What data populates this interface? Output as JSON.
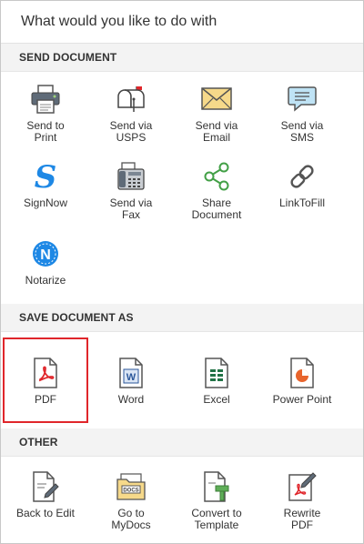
{
  "header": {
    "title": "What would you like to do with"
  },
  "sections": {
    "send": {
      "title": "SEND DOCUMENT",
      "items": [
        {
          "label": "Send to\nPrint",
          "icon": "printer-icon"
        },
        {
          "label": "Send via\nUSPS",
          "icon": "mailbox-icon"
        },
        {
          "label": "Send via\nEmail",
          "icon": "envelope-icon"
        },
        {
          "label": "Send via\nSMS",
          "icon": "chat-bubble-icon"
        },
        {
          "label": "SignNow",
          "icon": "signnow-icon"
        },
        {
          "label": "Send via\nFax",
          "icon": "fax-icon"
        },
        {
          "label": "Share\nDocument",
          "icon": "share-icon"
        },
        {
          "label": "LinkToFill",
          "icon": "link-icon"
        },
        {
          "label": "Notarize",
          "icon": "notarize-icon"
        }
      ]
    },
    "save": {
      "title": "SAVE DOCUMENT AS",
      "items": [
        {
          "label": "PDF",
          "icon": "pdf-file-icon",
          "selected": true
        },
        {
          "label": "Word",
          "icon": "word-file-icon"
        },
        {
          "label": "Excel",
          "icon": "excel-file-icon"
        },
        {
          "label": "Power Point",
          "icon": "powerpoint-file-icon"
        }
      ]
    },
    "other": {
      "title": "OTHER",
      "items": [
        {
          "label": "Back to Edit",
          "icon": "edit-document-icon"
        },
        {
          "label": "Go to\nMyDocs",
          "icon": "docs-folder-icon"
        },
        {
          "label": "Convert to\nTemplate",
          "icon": "template-icon"
        },
        {
          "label": "Rewrite\nPDF",
          "icon": "rewrite-pdf-icon"
        }
      ]
    }
  },
  "colors": {
    "selected_border": "#e0262b",
    "pdf_red": "#e0262b",
    "word_blue": "#2b579a",
    "excel_green": "#217346",
    "blue_accent": "#1e88e5"
  }
}
